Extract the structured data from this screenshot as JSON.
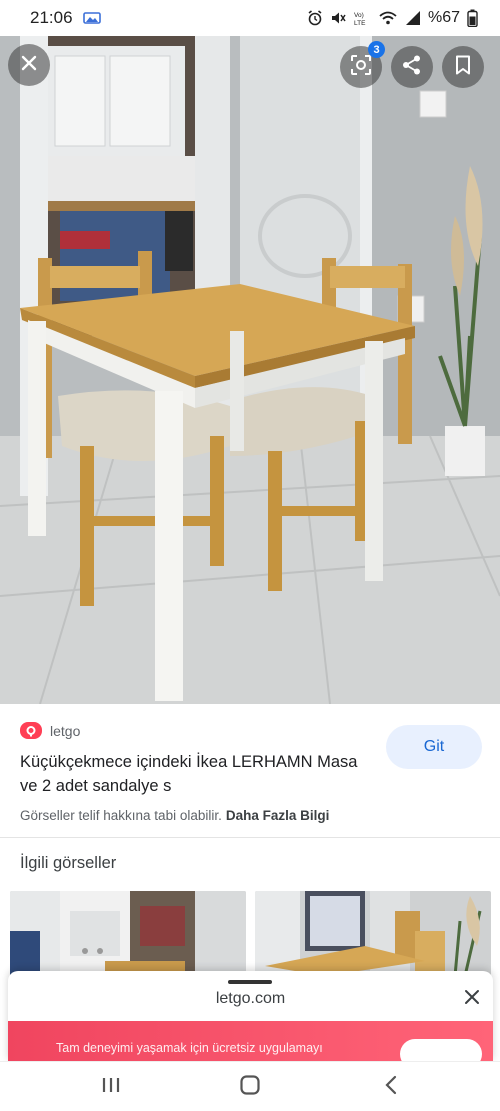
{
  "status_bar": {
    "time": "21:06",
    "battery": "%67",
    "icons": [
      "gallery-icon",
      "alarm-icon",
      "mute-icon",
      "volte-icon",
      "wifi-icon",
      "signal-icon"
    ]
  },
  "viewer": {
    "lens_badge": "3",
    "icons": [
      "close-icon",
      "lens-icon",
      "share-icon",
      "bookmark-icon"
    ]
  },
  "source": {
    "name": "letgo",
    "title": "Küçükçekmece içindeki İkea LERHAMN Masa ve 2 adet sandalye s",
    "visit_label": "Git",
    "copyright_note": "Görseller telif hakkına tabi olabilir.",
    "more_info": "Daha Fazla Bilgi"
  },
  "related": {
    "title": "İlgili görseller"
  },
  "sheet": {
    "domain": "letgo.com",
    "promo_text": "Tam deneyimi yaşamak için ücretsiz uygulamayı"
  },
  "colors": {
    "accent": "#1a73e8",
    "visit_bg": "#e8f0fe",
    "visit_text": "#1967d2",
    "letgo_red": "#ff3f55"
  }
}
